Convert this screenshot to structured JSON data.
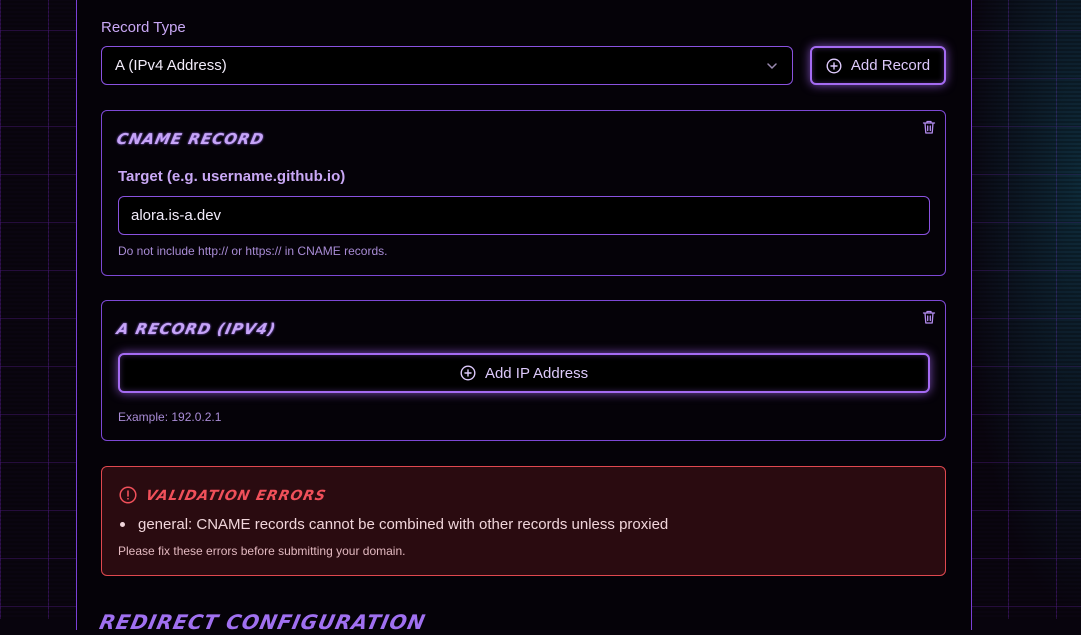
{
  "record_type": {
    "label": "Record Type",
    "selected": "A (IPv4 Address)",
    "add_button": "Add Record"
  },
  "cname_card": {
    "title": "CNAME Record",
    "field_label": "Target (e.g. username.github.io)",
    "field_value": "alora.is-a.dev",
    "hint": "Do not include http:// or https:// in CNAME records."
  },
  "a_card": {
    "title": "A Record (IPv4)",
    "add_button": "Add IP Address",
    "hint": "Example: 192.0.2.1"
  },
  "errors": {
    "title": "Validation Errors",
    "items": [
      "general: CNAME records cannot be combined with other records unless proxied"
    ],
    "note": "Please fix these errors before submitting your domain."
  },
  "next_section": {
    "title": "Redirect Configuration"
  },
  "colors": {
    "accent": "#a46bf2",
    "border": "#7d48d4",
    "error": "#e0484f",
    "background": "#050208"
  }
}
